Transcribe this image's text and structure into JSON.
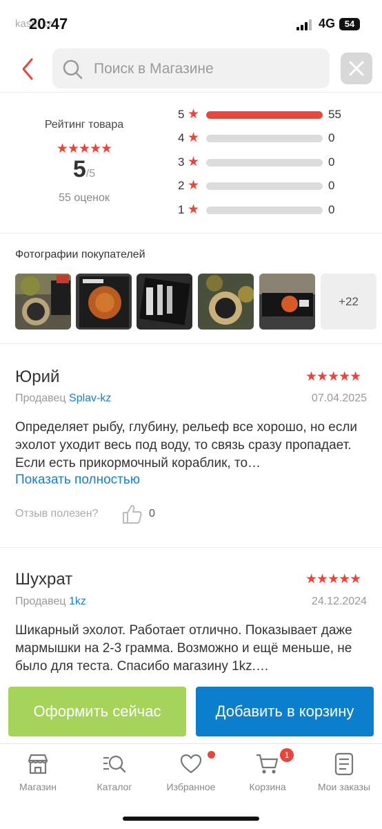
{
  "status_bar": {
    "time": "20:47",
    "network": "4G",
    "battery": "54",
    "ghost_text": "kaspi.kz"
  },
  "search": {
    "placeholder": "Поиск в Магазине"
  },
  "rating": {
    "label": "Рейтинг товара",
    "stars": "★★★★★",
    "score": "5",
    "out_of": "/5",
    "count_text": "55 оценок",
    "bars": [
      {
        "stars": "5",
        "count": "55",
        "fraction": 1.0
      },
      {
        "stars": "4",
        "count": "0",
        "fraction": 0
      },
      {
        "stars": "3",
        "count": "0",
        "fraction": 0
      },
      {
        "stars": "2",
        "count": "0",
        "fraction": 0
      },
      {
        "stars": "1",
        "count": "0",
        "fraction": 0
      }
    ]
  },
  "photos": {
    "title": "Фотографии покупателей",
    "more_count": "+22"
  },
  "reviews": [
    {
      "name": "Юрий",
      "stars": "★★★★★",
      "seller_prefix": "Продавец",
      "seller": "Splav-kz",
      "date": "07.04.2025",
      "text": "Определяет рыбу, глубину, рельеф все хорошо, но если эхолот уходит весь под воду, то связь сразу пропадает. Если есть прикормочный кораблик, то…",
      "show_more": "Показать полностью",
      "useful_label": "Отзыв полезен?",
      "likes": "0"
    },
    {
      "name": "Шухрат",
      "stars": "★★★★★",
      "seller_prefix": "Продавец",
      "seller": "1kz",
      "date": "24.12.2024",
      "text": "Шикарный эхолот. Работает отлично. Показывает даже мармышки на 2-3 грамма. Возможно и ещё меньше, не было для теста. Спасибо магазину 1kz.…"
    }
  ],
  "actions": {
    "buy_now": "Оформить сейчас",
    "add_to_cart": "Добавить в корзину"
  },
  "tabbar": {
    "items": [
      {
        "label": "Магазин",
        "icon": "store-icon"
      },
      {
        "label": "Каталог",
        "icon": "catalog-search-icon"
      },
      {
        "label": "Избранное",
        "icon": "heart-icon"
      },
      {
        "label": "Корзина",
        "icon": "cart-icon",
        "badge": "1"
      },
      {
        "label": "Мои заказы",
        "icon": "orders-icon"
      }
    ]
  },
  "colors": {
    "accent_red": "#e8453c",
    "link_blue": "#1a7fc1",
    "buy_green": "#a6d35a",
    "cart_blue": "#0b7fcb"
  }
}
